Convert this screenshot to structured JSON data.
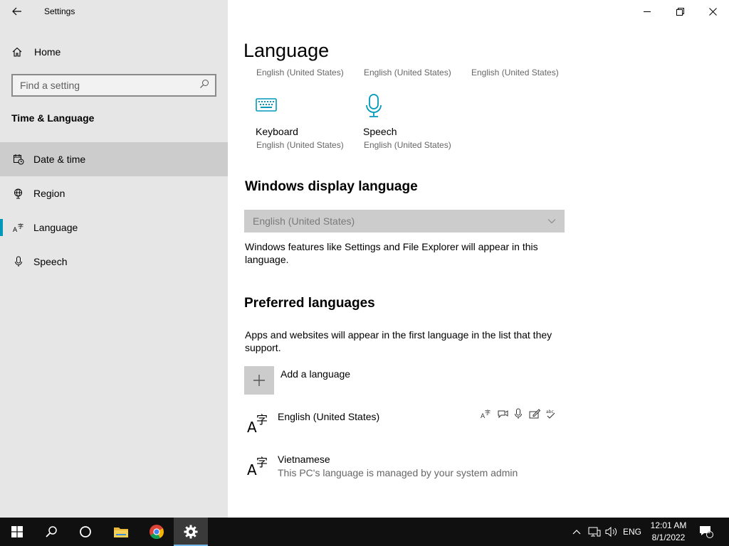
{
  "window": {
    "title": "Settings"
  },
  "sidebar": {
    "home_label": "Home",
    "search_placeholder": "Find a setting",
    "section_title": "Time & Language",
    "items": [
      {
        "label": "Date & time",
        "icon": "clock-calendar-icon"
      },
      {
        "label": "Region",
        "icon": "globe-icon"
      },
      {
        "label": "Language",
        "icon": "language-icon"
      },
      {
        "label": "Speech",
        "icon": "microphone-icon"
      }
    ]
  },
  "main": {
    "title": "Language",
    "top_tiles": [
      {
        "sub": "English (United States)"
      },
      {
        "sub": "English (United States)"
      },
      {
        "sub": "English (United States)"
      }
    ],
    "tiles": [
      {
        "label": "Keyboard",
        "sub": "English (United States)",
        "icon": "keyboard-icon"
      },
      {
        "label": "Speech",
        "sub": "English (United States)",
        "icon": "microphone-icon"
      }
    ],
    "display_language": {
      "heading": "Windows display language",
      "selected": "English (United States)",
      "description": "Windows features like Settings and File Explorer will appear in this language."
    },
    "preferred": {
      "heading": "Preferred languages",
      "description": "Apps and websites will appear in the first language in the list that they support.",
      "add_label": "Add a language",
      "languages": [
        {
          "name": "English (United States)",
          "note": ""
        },
        {
          "name": "Vietnamese",
          "note": "This PC's language is managed by your system admin"
        }
      ],
      "lang_glyph": "A字"
    }
  },
  "taskbar": {
    "tray_lang": "ENG",
    "time": "12:01 AM",
    "date": "8/1/2022",
    "notification_count": "1"
  },
  "colors": {
    "accent": "#0099bc",
    "sidebar_bg": "#e6e6e6",
    "taskbar_bg": "#101010"
  }
}
